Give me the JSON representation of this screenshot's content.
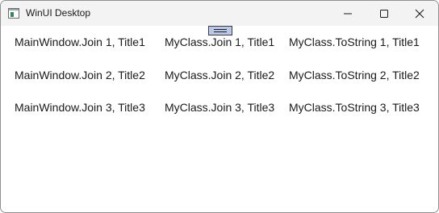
{
  "window": {
    "title": "WinUI Desktop",
    "app_icon": "window-app-icon",
    "controls": {
      "minimize_icon": "minimize-icon",
      "maximize_icon": "maximize-icon",
      "close_icon": "close-icon"
    }
  },
  "list": {
    "rows": [
      {
        "main_join": "MainWindow.Join 1, Title1",
        "class_join": "MyClass.Join 1, Title1",
        "class_tostring": "MyClass.ToString 1, Title1"
      },
      {
        "main_join": "MainWindow.Join 2, Title2",
        "class_join": "MyClass.Join 2, Title2",
        "class_tostring": "MyClass.ToString 2, Title2"
      },
      {
        "main_join": "MainWindow.Join 3, Title3",
        "class_join": "MyClass.Join 3, Title3",
        "class_tostring": "MyClass.ToString 3, Title3"
      }
    ]
  },
  "colors": {
    "titlebar_bg": "#f3f3f3",
    "debug_handle_bg": "#b8c7ea"
  }
}
